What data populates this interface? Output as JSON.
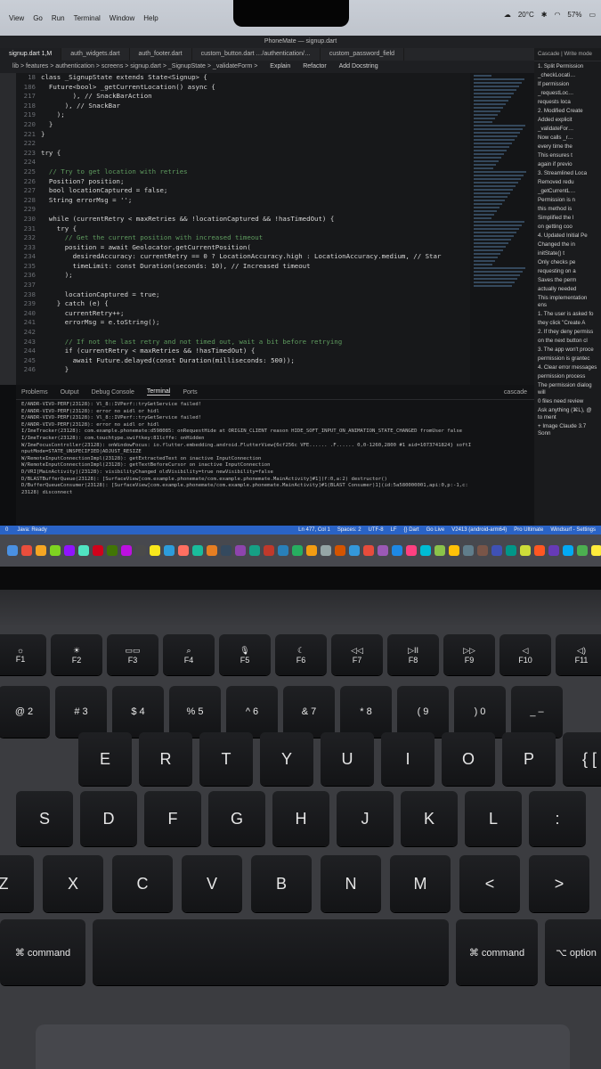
{
  "menubar": {
    "items": [
      "View",
      "Go",
      "Run",
      "Terminal",
      "Window",
      "Help"
    ],
    "weather": "20°C",
    "battery": "57%"
  },
  "window_title": "PhoneMate — signup.dart",
  "tabs": [
    "signup.dart 1,M",
    "auth_widgets.dart",
    "auth_footer.dart",
    "custom_button.dart …/authentication/…",
    "custom_password_field"
  ],
  "breadcrumb": "lib > features > authentication > screens > signup.dart > _SignupState > _validateForm >",
  "breadcrumb_actions": [
    "Explain",
    "Refactor",
    "Add Docstring"
  ],
  "code_lines": [
    {
      "n": "18",
      "t": "class _SignupState extends State<Signup> {"
    },
    {
      "n": "186",
      "t": "  Future<bool> _getCurrentLocation() async {"
    },
    {
      "n": "217",
      "t": "        ), // SnackBarAction"
    },
    {
      "n": "218",
      "t": "      ), // SnackBar"
    },
    {
      "n": "219",
      "t": "    );"
    },
    {
      "n": "220",
      "t": "  }"
    },
    {
      "n": "221",
      "t": "}"
    },
    {
      "n": "222",
      "t": ""
    },
    {
      "n": "223",
      "t": "try {"
    },
    {
      "n": "224",
      "t": ""
    },
    {
      "n": "225",
      "t": "  // Try to get location with retries"
    },
    {
      "n": "226",
      "t": "  Position? position;"
    },
    {
      "n": "227",
      "t": "  bool locationCaptured = false;"
    },
    {
      "n": "228",
      "t": "  String errorMsg = '';"
    },
    {
      "n": "229",
      "t": ""
    },
    {
      "n": "230",
      "t": "  while (currentRetry < maxRetries && !locationCaptured && !hasTimedOut) {"
    },
    {
      "n": "231",
      "t": "    try {"
    },
    {
      "n": "232",
      "t": "      // Get the current position with increased timeout"
    },
    {
      "n": "233",
      "t": "      position = await Geolocator.getCurrentPosition("
    },
    {
      "n": "234",
      "t": "        desiredAccuracy: currentRetry == 0 ? LocationAccuracy.high : LocationAccuracy.medium, // Star"
    },
    {
      "n": "235",
      "t": "        timeLimit: const Duration(seconds: 10), // Increased timeout"
    },
    {
      "n": "236",
      "t": "      );"
    },
    {
      "n": "237",
      "t": ""
    },
    {
      "n": "238",
      "t": "      locationCaptured = true;"
    },
    {
      "n": "239",
      "t": "    } catch (e) {"
    },
    {
      "n": "240",
      "t": "      currentRetry++;"
    },
    {
      "n": "241",
      "t": "      errorMsg = e.toString();"
    },
    {
      "n": "242",
      "t": ""
    },
    {
      "n": "243",
      "t": "      // If not the last retry and not timed out, wait a bit before retrying"
    },
    {
      "n": "244",
      "t": "      if (currentRetry < maxRetries && !hasTimedOut) {"
    },
    {
      "n": "245",
      "t": "        await Future.delayed(const Duration(milliseconds: 500));"
    },
    {
      "n": "246",
      "t": "      }"
    }
  ],
  "panel_tabs": [
    "Problems",
    "Output",
    "Debug Console",
    "Terminal",
    "Ports"
  ],
  "panel_active": "Terminal",
  "terminal_name": "cascade",
  "log_lines": [
    "E/ANDR-VIVO-PERF(23128): Vl_8::IVPerf::tryGetService failed!",
    "E/ANDR-VIVO-PERF(23128): error no aidl or hidl",
    "E/ANDR-VIVO-PERF(23128): Vl_8::IVPerf::tryGetService failed!",
    "E/ANDR-VIVO-PERF(23128): error no aidl or hidl",
    "I/ImeTracker(23128): com.example.phonemate:d598085: onRequestHide at ORIGIN_CLIENT reason HIDE_SOFT_INPUT_ON_ANIMATION_STATE_CHANGED fromUser false",
    "I/ImeTracker(23128): com.touchtype.swiftkey:81lcffe: onHidden",
    "W/ImeFocusController(23128): onWindowFocus: io.flutter.embedding.android.FlutterView{6cf256c VFE...... .F...... 0,0-1260,2800 #1 aid=1073741824} softI",
    "nputMode=STATE_UNSPECIFIED|ADJUST_RESIZE",
    "W/RemoteInputConnectionImpl(23128): getExtractedText on inactive InputConnection",
    "W/RemoteInputConnectionImpl(23128): getTextBeforeCursor on inactive InputConnection",
    "D/VRI[MainActivity](23128): visibilityChanged oldVisibility=true newVisibility=false",
    "D/BLASTBufferQueue(23128): [SurfaceView[com.example.phonemate/com.example.phonemate.MainActivity]#1](f:0,a:2) destructor()",
    "D/BufferQueueConsumer(23128): [SurfaceView[com.example.phonemate/com.example.phonemate.MainActivity]#1(BLAST Consumer)1](id:5a580000001,api:0,p:-1,c:",
    "23128) disconnect"
  ],
  "statusbar": {
    "left": [
      "0",
      "Java: Ready"
    ],
    "right": [
      "Ln 477, Col 1",
      "Spaces: 2",
      "UTF-8",
      "LF",
      "{} Dart",
      "Go Live",
      "V2413 (android-arm64)",
      "Pro Ultimate",
      "Windsurf - Settings"
    ]
  },
  "sidepanel": {
    "header": "Cascade | Write mode",
    "items": [
      "1. Split Permission",
      "_checkLocati…",
      "If permission",
      "_requestLoc…",
      "requests loca",
      "2. Modified Create",
      "Added explicit",
      "_validateFor…",
      "Now calls _r…",
      "every time the",
      "This ensures t",
      "again if previo",
      "3. Streamlined Loca",
      "Removed redu",
      "_getCurrentL…",
      "Permission is n",
      "this method is",
      "Simplified the l",
      "on getting coo",
      "4. Updated Initial Pe",
      "Changed the in",
      "initState() t",
      "Only checks pe",
      "requesting on a",
      "Saves the perm",
      "actually needed",
      "This implementation ens",
      "1. The user is asked fo",
      "they click \"Create A",
      "2. If they deny permiss",
      "on the next button cl",
      "3. The app won't proce",
      "permission is grantec",
      "4. Clear error messages",
      "permission process",
      "The permission dialog will",
      "0 files need review",
      "Ask anything (⌘L), @ to ment",
      "+ Image   Claude 3.7 Sonn"
    ]
  },
  "keyboard": {
    "fn_row": [
      {
        "glyph": "☼",
        "label": "F1"
      },
      {
        "glyph": "☀",
        "label": "F2"
      },
      {
        "glyph": "▭▭",
        "label": "F3"
      },
      {
        "glyph": "⌕",
        "label": "F4"
      },
      {
        "glyph": "🎙",
        "label": "F5"
      },
      {
        "glyph": "☾",
        "label": "F6"
      },
      {
        "glyph": "◁◁",
        "label": "F7"
      },
      {
        "glyph": "▷II",
        "label": "F8"
      },
      {
        "glyph": "▷▷",
        "label": "F9"
      },
      {
        "glyph": "◁",
        "label": "F10"
      },
      {
        "glyph": "◁)",
        "label": "F11"
      }
    ],
    "num_row": [
      "@ 2",
      "# 3",
      "$ 4",
      "% 5",
      "^ 6",
      "& 7",
      "* 8",
      "( 9",
      ") 0",
      "_ –"
    ],
    "row_q": [
      "E",
      "R",
      "T",
      "Y",
      "U",
      "I",
      "O",
      "P",
      "{ ["
    ],
    "row_a": [
      "S",
      "D",
      "F",
      "G",
      "H",
      "J",
      "K",
      "L",
      ":"
    ],
    "row_z": [
      "Z",
      "X",
      "C",
      "V",
      "B",
      "N",
      "M",
      "<",
      ">"
    ],
    "bottom": [
      "⌘ command",
      "",
      "⌘ command",
      "⌥ option"
    ]
  }
}
